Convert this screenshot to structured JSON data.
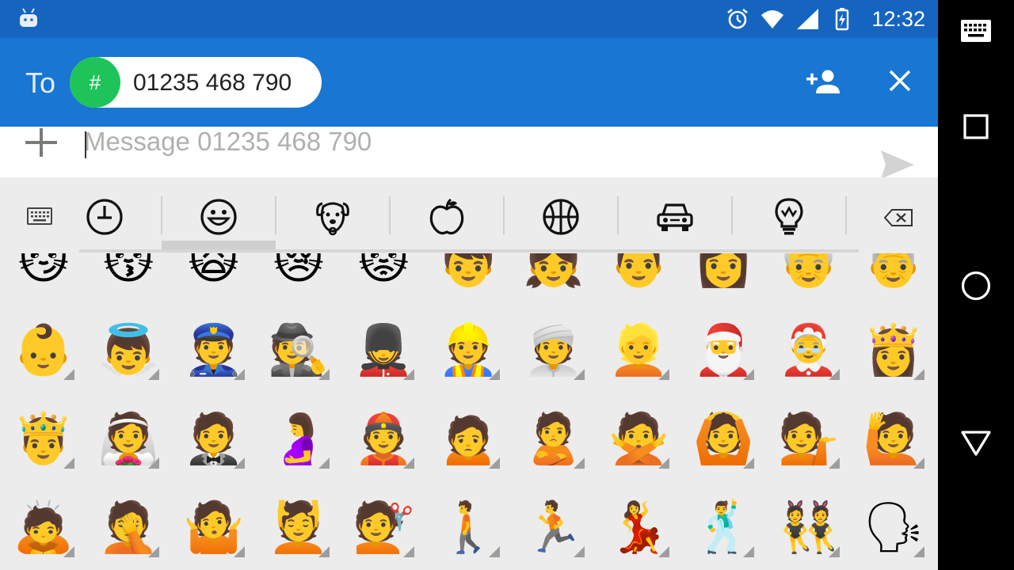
{
  "status_bar": {
    "time": "12:32",
    "icons": [
      "android-icon",
      "alarm-icon",
      "wifi-icon",
      "signal-icon",
      "battery-charging-icon"
    ]
  },
  "app_bar": {
    "to_label": "To",
    "recipient_avatar": "#",
    "recipient": "01235 468 790",
    "actions": [
      "add-person-icon",
      "close-icon"
    ]
  },
  "compose": {
    "placeholder": "Message 01235 468 790",
    "value": "",
    "icons": [
      "plus-icon",
      "send-icon"
    ]
  },
  "emoji_keyboard": {
    "tabs": [
      "recent-icon",
      "smiley-icon",
      "animal-icon",
      "food-icon",
      "sports-icon",
      "travel-icon",
      "objects-icon"
    ],
    "active_tab": "smiley-icon",
    "rows": [
      [
        "😼",
        "😽",
        "🙀",
        "😿",
        "😾",
        "👦",
        "👧",
        "👨",
        "👩",
        "👴",
        "👵"
      ],
      [
        "👶",
        "👼",
        "👮",
        "🕵",
        "💂",
        "👷",
        "👳",
        "👱",
        "🎅",
        "🤶",
        "👸"
      ],
      [
        "🤴",
        "👰",
        "🤵",
        "🤰",
        "👲",
        "🙍",
        "🙎",
        "🙅",
        "🙆",
        "💁",
        "🙋"
      ],
      [
        "🙇",
        "🤦",
        "🤷",
        "💆",
        "💇",
        "🚶",
        "🏃",
        "💃",
        "🕺",
        "👯",
        "🗣"
      ]
    ]
  },
  "colors": {
    "status_bar": "#1565c0",
    "app_bar": "#1976d2",
    "avatar": "#1ec45a",
    "keyboard_bg": "#ececec"
  }
}
